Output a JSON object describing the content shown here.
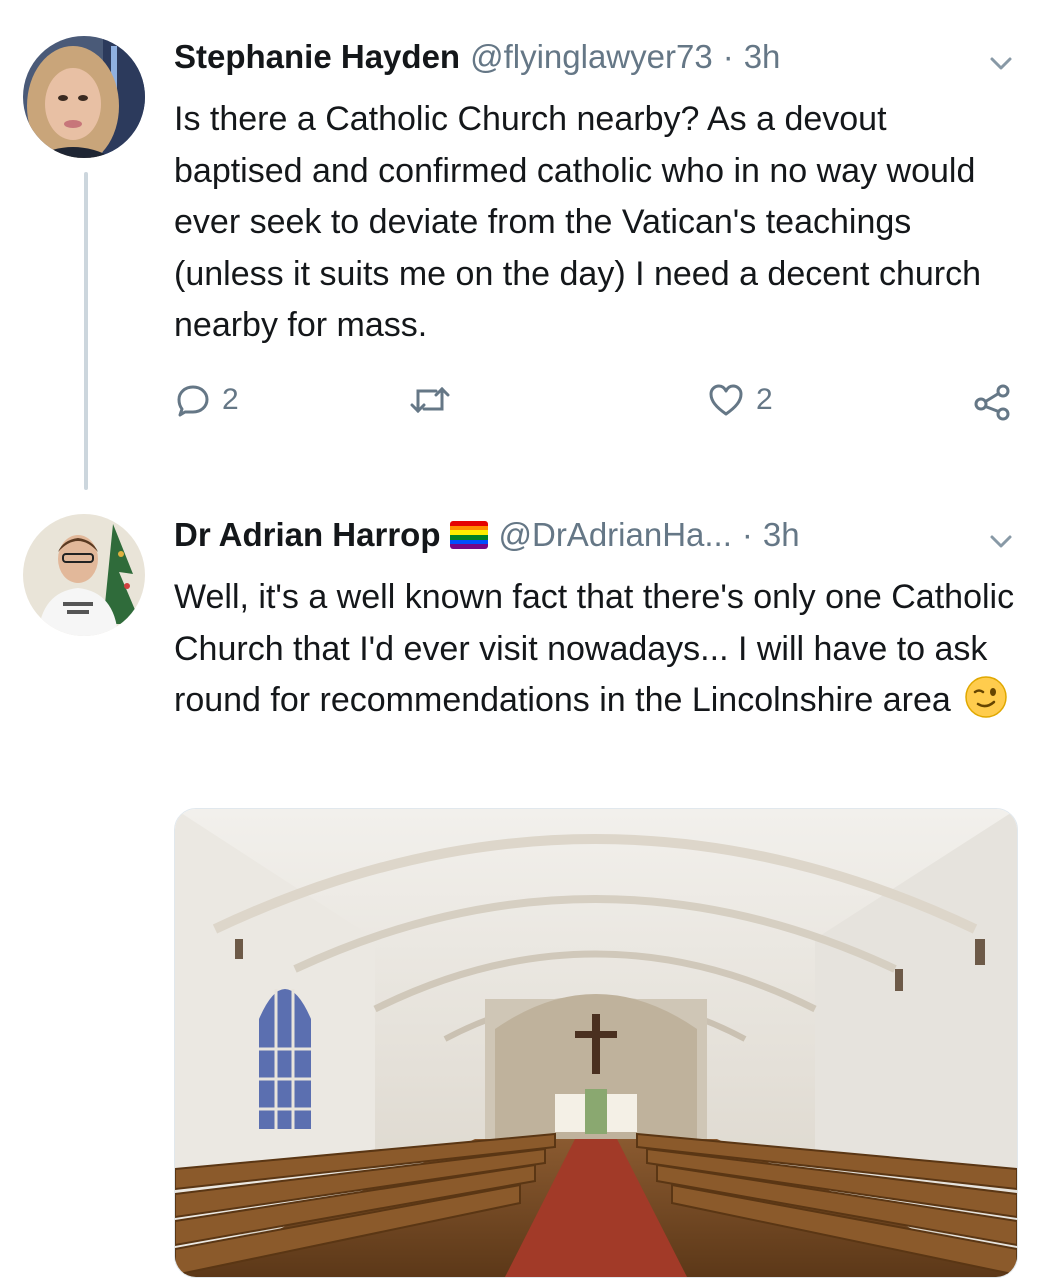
{
  "tweets": [
    {
      "name": "Stephanie Hayden",
      "handle": "@flyinglawyer73",
      "separator": "·",
      "time": "3h",
      "text": "Is there a Catholic Church nearby? As a devout baptised and confirmed catholic who in no way would ever seek to deviate from the Vatican's teachings (unless it suits me on the day) I need a decent church nearby for mass.",
      "reply_count": "2",
      "like_count": "2"
    },
    {
      "name": "Dr Adrian Harrop",
      "handle": "@DrAdrianHa...",
      "separator": "·",
      "time": "3h",
      "text": "Well, it's a well known fact that there's only one Catholic Church that I'd ever visit nowadays... I will have to ask round for recommendations in the Lincolnshire area"
    }
  ],
  "colors": {
    "text": "#14171a",
    "secondary": "#657786",
    "thread_line": "#ccd6dd",
    "pride_flag": [
      "#e40303",
      "#ff8c00",
      "#ffed00",
      "#008026",
      "#004dff",
      "#750787"
    ]
  },
  "icons": [
    "chevron-down-icon",
    "reply-icon",
    "retweet-icon",
    "like-icon",
    "share-icon",
    "winking-face-emoji",
    "pride-flag-emoji"
  ]
}
